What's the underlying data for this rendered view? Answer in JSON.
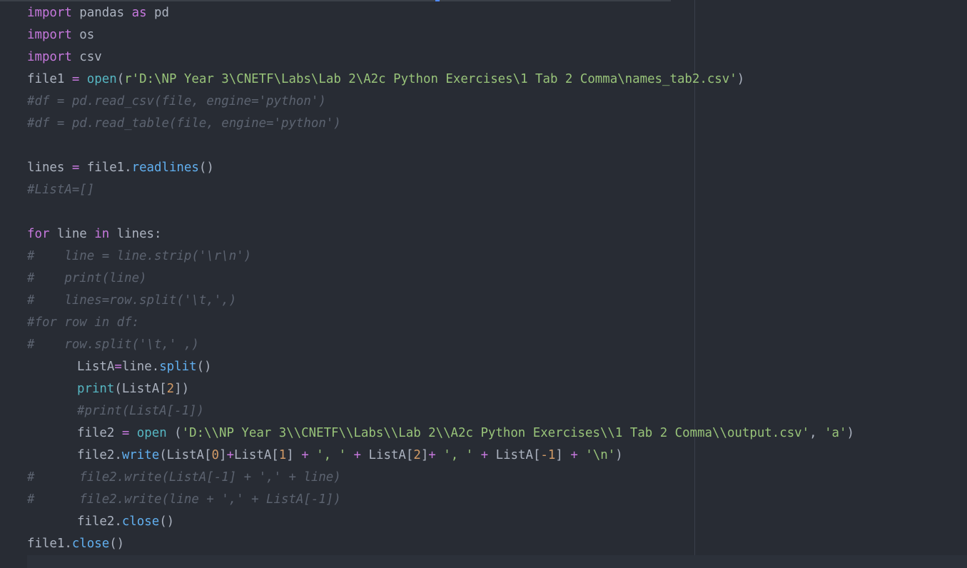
{
  "editor": {
    "language": "python",
    "theme_colors": {
      "background": "#282c34",
      "text": "#abb2bf",
      "keyword": "#c678dd",
      "function": "#61afef",
      "builtin": "#56b6c2",
      "string": "#98c379",
      "number": "#d19a66",
      "comment": "#5c6370"
    }
  },
  "code": {
    "l1": [
      "import",
      " pandas ",
      "as",
      " pd"
    ],
    "l2": [
      "import",
      " os"
    ],
    "l3": [
      "import",
      " csv"
    ],
    "l4": [
      "file1 ",
      "=",
      " ",
      "open",
      "(",
      "r'D:\\NP Year 3\\CNETF\\Labs\\Lab 2\\A2c Python Exercises\\1 Tab 2 Comma\\names_tab2.csv'",
      ")"
    ],
    "l5": "#df = pd.read_csv(file, engine='python')",
    "l6": "#df = pd.read_table(file, engine='python')",
    "l8": [
      "lines ",
      "=",
      " file1.",
      "readlines",
      "()"
    ],
    "l9": "#ListA=[]",
    "l11": [
      "for",
      " line ",
      "in",
      " lines:"
    ],
    "l12": "#    line = line.strip('\\r\\n')",
    "l13": "#    print(line)",
    "l14": "#    lines=row.split('\\t,',)",
    "l15": "#for row in df:",
    "l16": "#    row.split('\\t,' ,)",
    "l17": [
      "ListA",
      "=",
      "line.",
      "split",
      "()"
    ],
    "l18": [
      "print",
      "(ListA[",
      "2",
      "])"
    ],
    "l19": "#print(ListA[-1])",
    "l20": [
      "file2 ",
      "=",
      " ",
      "open",
      " (",
      "'D:\\\\NP Year 3\\\\CNETF\\\\Labs\\\\Lab 2\\\\A2c Python Exercises\\\\1 Tab 2 Comma\\\\output.csv'",
      ", ",
      "'a'",
      ")"
    ],
    "l21": [
      "file2.",
      "write",
      "(ListA[",
      "0",
      "]",
      "+",
      "ListA[",
      "1",
      "] ",
      "+",
      " ",
      "', '",
      " ",
      "+",
      " ListA[",
      "2",
      "]",
      "+",
      " ",
      "', '",
      " ",
      "+",
      " ListA[",
      "-1",
      "] ",
      "+",
      " ",
      "'\\n'",
      ")"
    ],
    "l22": "#      file2.write(ListA[-1] + ',' + line)",
    "l23": "#      file2.write(line + ',' + ListA[-1])",
    "l24": [
      "file2.",
      "close",
      "()"
    ],
    "l25": [
      "file1.",
      "close",
      "()"
    ]
  }
}
